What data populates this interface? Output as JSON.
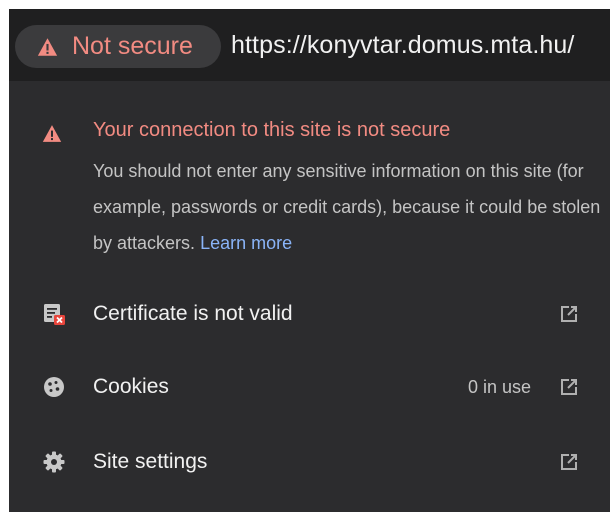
{
  "address_bar": {
    "security_chip": {
      "label": "Not secure",
      "icon": "warning-triangle-icon",
      "color": "#f28b82"
    },
    "url": "https://konyvtar.domus.mta.hu/"
  },
  "security_warning": {
    "icon": "warning-triangle-icon",
    "title": "Your connection to this site is not secure",
    "description": "You should not enter any sensitive information on this site (for example, passwords or credit cards), because it could be stolen by attackers.",
    "learn_more": "Learn more",
    "link_color": "#8ab4f8"
  },
  "items": [
    {
      "icon": "certificate-invalid-icon",
      "label": "Certificate is not valid",
      "meta": "",
      "trailing_icon": "open-external-icon"
    },
    {
      "icon": "cookie-icon",
      "label": "Cookies",
      "meta": "0 in use",
      "trailing_icon": "open-external-icon"
    },
    {
      "icon": "gear-icon",
      "label": "Site settings",
      "meta": "",
      "trailing_icon": "open-external-icon"
    }
  ],
  "theme": {
    "background": "#2c2c2e",
    "toolbar": "#1f1f20",
    "chip": "#3b3b3d"
  }
}
